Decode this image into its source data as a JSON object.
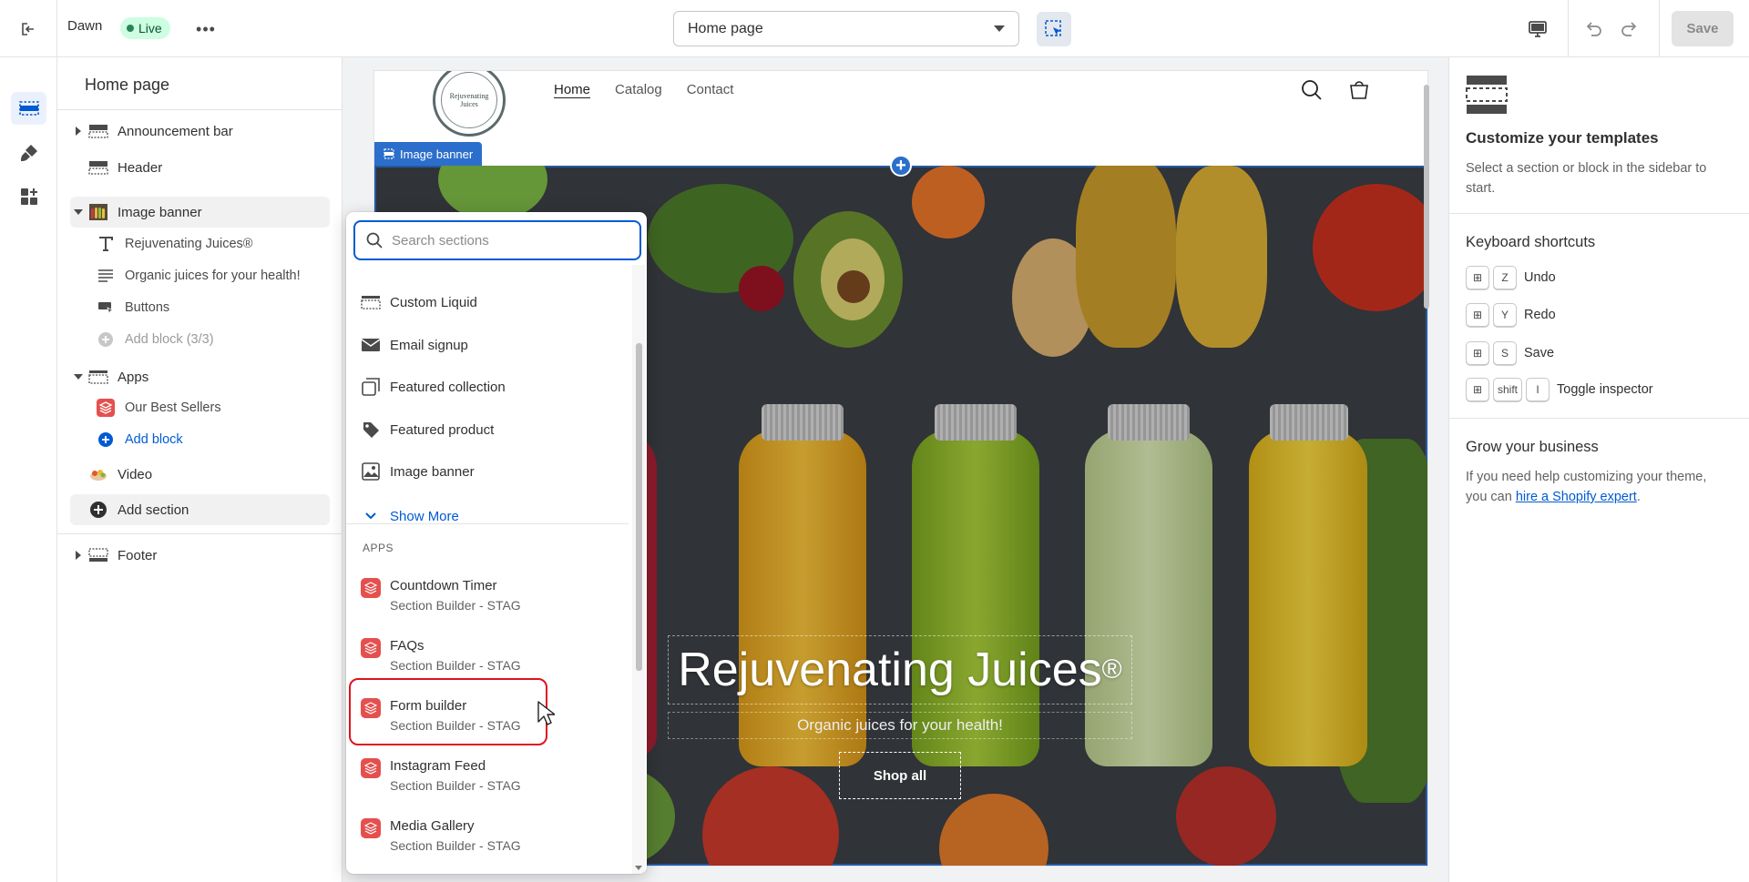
{
  "topbar": {
    "theme_name": "Dawn",
    "live_label": "Live",
    "more_label": "•••",
    "page_select": "Home page",
    "save_label": "Save"
  },
  "sidebar": {
    "title": "Home page",
    "items": [
      {
        "label": "Announcement bar",
        "icon": "announcement-bar-icon"
      },
      {
        "label": "Header",
        "icon": "header-icon"
      },
      {
        "label": "Image banner",
        "icon": "image-banner-thumb"
      },
      {
        "label": "Rejuvenating Juices®",
        "icon": "text-heading-icon"
      },
      {
        "label": "Organic juices for your health!",
        "icon": "text-paragraph-icon"
      },
      {
        "label": "Buttons",
        "icon": "buttons-icon"
      },
      {
        "label": "Add block (3/3)",
        "icon": "add-circle-icon"
      },
      {
        "label": "Apps",
        "icon": "apps-section-icon"
      },
      {
        "label": "Our Best Sellers",
        "icon": "app-block-icon"
      },
      {
        "label": "Add block",
        "icon": "add-circle-icon"
      },
      {
        "label": "Video",
        "icon": "video-thumb"
      },
      {
        "label": "Add section",
        "icon": "add-circle-icon"
      },
      {
        "label": "Footer",
        "icon": "footer-icon"
      }
    ]
  },
  "store": {
    "nav": [
      "Home",
      "Catalog",
      "Contact"
    ],
    "logo_text": "Rejuvenating Juices",
    "section_tag": "Image banner",
    "hero_title": "Rejuvenating Juices",
    "hero_title_mark": "®",
    "hero_subtitle": "Organic juices for your health!",
    "hero_button": "Shop all"
  },
  "picker": {
    "search_placeholder": "Search sections",
    "sections": [
      {
        "label": "Custom Liquid",
        "icon": "custom-liquid-icon"
      },
      {
        "label": "Email signup",
        "icon": "email-icon"
      },
      {
        "label": "Featured collection",
        "icon": "collection-icon"
      },
      {
        "label": "Featured product",
        "icon": "tag-icon"
      },
      {
        "label": "Image banner",
        "icon": "image-icon"
      }
    ],
    "show_more": "Show More",
    "apps_heading": "APPS",
    "apps": [
      {
        "name": "Countdown Timer",
        "source": "Section Builder - STAG"
      },
      {
        "name": "FAQs",
        "source": "Section Builder - STAG"
      },
      {
        "name": "Form builder",
        "source": "Section Builder - STAG"
      },
      {
        "name": "Instagram Feed",
        "source": "Section Builder - STAG"
      },
      {
        "name": "Media Gallery",
        "source": "Section Builder - STAG"
      }
    ]
  },
  "right_panel": {
    "customize_title": "Customize your templates",
    "customize_text": "Select a section or block in the sidebar to start.",
    "shortcuts_title": "Keyboard shortcuts",
    "shortcuts": [
      {
        "keys": [
          "⊞",
          "Z"
        ],
        "label": "Undo"
      },
      {
        "keys": [
          "⊞",
          "Y"
        ],
        "label": "Redo"
      },
      {
        "keys": [
          "⊞",
          "S"
        ],
        "label": "Save"
      },
      {
        "keys": [
          "⊞",
          "shift",
          "I"
        ],
        "label": "Toggle inspector"
      }
    ],
    "grow_title": "Grow your business",
    "grow_text": "If you need help customizing your theme, you can ",
    "grow_link": "hire a Shopify expert",
    "grow_end": "."
  },
  "colors": {
    "accent": "#005bd3",
    "section_blue": "#2c6ecb",
    "app_red": "#e4504e",
    "highlight_red": "#e0131f",
    "live_green": "#29845a"
  }
}
